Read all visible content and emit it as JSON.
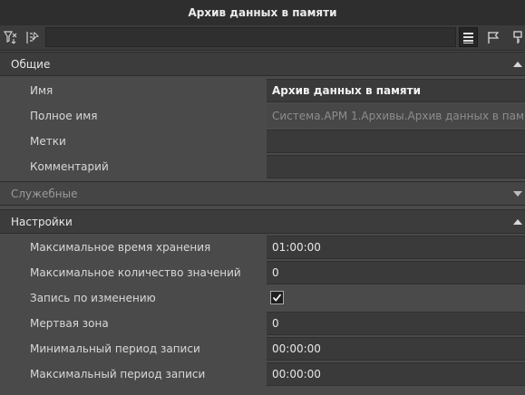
{
  "window": {
    "title": "Архив данных в памяти"
  },
  "toolbar": {
    "buttons_left": [
      "filter-icon",
      "pin-list-icon"
    ],
    "buttons_right": [
      "list-view-icon",
      "flag-icon",
      "key-icon"
    ],
    "search_value": ""
  },
  "sections": {
    "general": {
      "title": "Общие",
      "expanded": true,
      "rows": {
        "name": {
          "label": "Имя",
          "value": "Архив данных в памяти"
        },
        "full_name": {
          "label": "Полное имя",
          "value": "Система.АРМ 1.Архивы.Архив данных в памяти"
        },
        "tags": {
          "label": "Метки",
          "value": ""
        },
        "comment": {
          "label": "Комментарий",
          "value": ""
        }
      }
    },
    "service": {
      "title": "Служебные",
      "expanded": false
    },
    "settings": {
      "title": "Настройки",
      "expanded": true,
      "rows": {
        "max_storage_time": {
          "label": "Максимальное время хранения",
          "value": "01:00:00"
        },
        "max_values_count": {
          "label": "Максимальное количество значений",
          "value": "0"
        },
        "record_on_change": {
          "label": "Запись по изменению",
          "checked": true
        },
        "dead_zone": {
          "label": "Мертвая зона",
          "value": "0"
        },
        "min_record_period": {
          "label": "Минимальный период записи",
          "value": "00:00:00"
        },
        "max_record_period": {
          "label": "Максимальный период записи",
          "value": "00:00:00"
        }
      }
    }
  },
  "colors": {
    "background": "#4a4a4a",
    "titlebar": "#2e2e2e",
    "section_header": "#3c3c3c",
    "field": "#3a3a3a",
    "text": "#dcdcdc"
  }
}
